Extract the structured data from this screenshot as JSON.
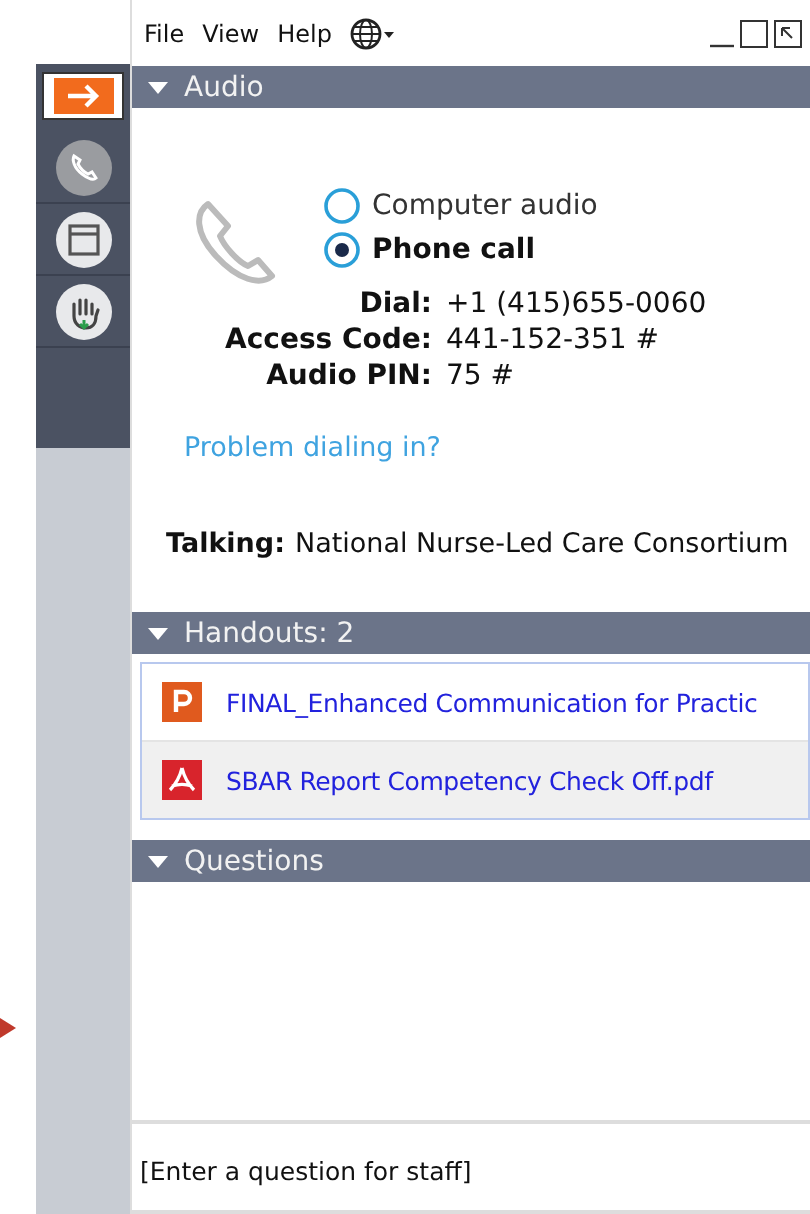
{
  "menu": [
    "File",
    "View",
    "Help"
  ],
  "sidebar": {
    "items": [
      {
        "kind": "share",
        "selected": true
      },
      {
        "kind": "phone",
        "selected": false
      },
      {
        "kind": "window",
        "selected": false
      },
      {
        "kind": "hand",
        "selected": false
      }
    ]
  },
  "audio": {
    "title": "Audio",
    "expanded": true,
    "options": [
      {
        "label": "Computer audio",
        "selected": false
      },
      {
        "label": "Phone call",
        "selected": true
      }
    ],
    "details": [
      {
        "label": "Dial:",
        "value": "+1 (415)655-0060"
      },
      {
        "label": "Access Code:",
        "value": "441-152-351 #"
      },
      {
        "label": "Audio PIN:",
        "value": "75 #"
      }
    ],
    "help_link": "Problem dialing in?",
    "talking": {
      "label": "Talking:",
      "value": "National Nurse-Led Care Consortium"
    }
  },
  "handouts": {
    "title": "Handouts: 2",
    "expanded": true,
    "items": [
      {
        "kind": "ppt",
        "name": "FINAL_Enhanced Communication for Practic"
      },
      {
        "kind": "pdf",
        "name": "SBAR Report Competency Check Off.pdf"
      }
    ]
  },
  "questions": {
    "title": "Questions",
    "expanded": true,
    "placeholder": "[Enter a question for staff]"
  }
}
